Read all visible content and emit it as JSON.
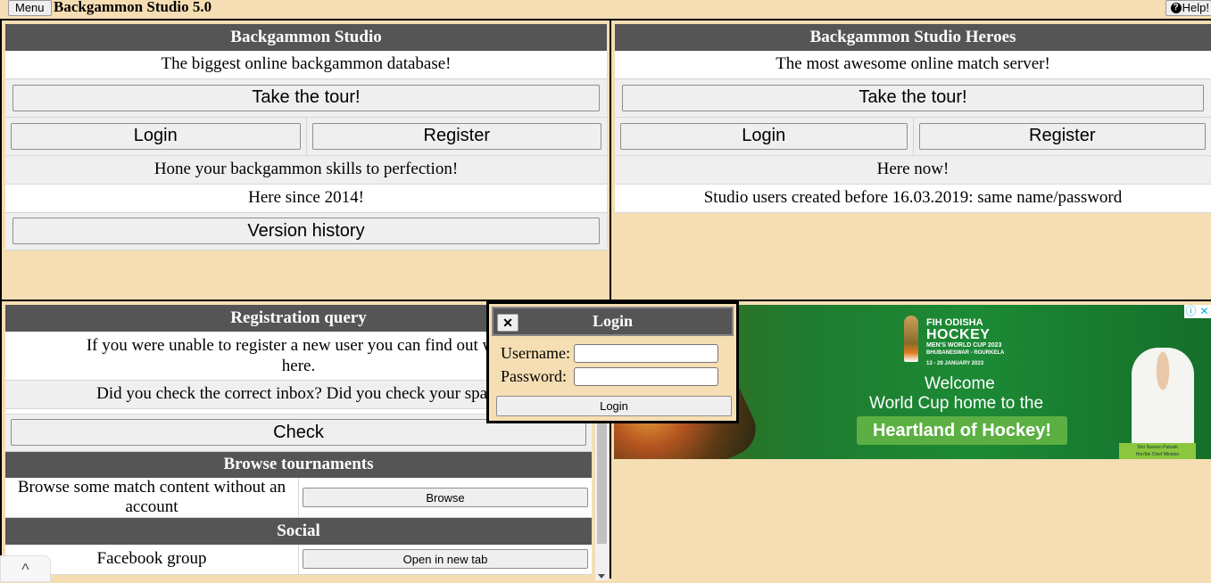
{
  "topbar": {
    "menu_label": "Menu",
    "app_title": "Backgammon Studio 5.0",
    "help_label": "Help!"
  },
  "studio": {
    "title": "Backgammon Studio",
    "tagline": "The biggest online backgammon database!",
    "tour_label": "Take the tour!",
    "login_label": "Login",
    "register_label": "Register",
    "hone": "Hone your backgammon skills to perfection!",
    "since": "Here since 2014!",
    "version_history_label": "Version history"
  },
  "heroes": {
    "title": "Backgammon Studio Heroes",
    "tagline": "The most awesome online match server!",
    "tour_label": "Take the tour!",
    "login_label": "Login",
    "register_label": "Register",
    "here_now": "Here now!",
    "note": "Studio users created before 16.03.2019: same name/password"
  },
  "registration": {
    "title": "Registration query",
    "text1": "If you were unable to register a new user you can find out what happened here.",
    "text1_visible_line1": "If you were unable to register a new user you can find out wha",
    "text1_visible_line2": "here.",
    "text2": "Did you check the correct inbox? Did you check your spam",
    "check_label": "Check"
  },
  "browse": {
    "title": "Browse tournaments",
    "text": "Browse some match content without an account",
    "button_label": "Browse"
  },
  "social": {
    "title": "Social",
    "items": [
      {
        "label": "Facebook group",
        "button_label": "Open in new tab"
      }
    ]
  },
  "login_dialog": {
    "title": "Login",
    "close_label": "✕",
    "username_label": "Username:",
    "password_label": "Password:",
    "username_value": "",
    "password_value": "",
    "submit_label": "Login"
  },
  "ad": {
    "brand_line1": "FIH ODISHA",
    "brand_line2": "HOCKEY",
    "brand_line3": "MEN'S WORLD CUP 2023",
    "brand_line4": "BHUBANESWAR - ROURKELA",
    "dates": "13 - 29 JANUARY 2023",
    "welcome": "Welcome",
    "line2": "World Cup home to the",
    "cta": "Heartland of Hockey!",
    "person_name": "Shri Naveen Patnaik",
    "person_title": "Hon'ble Chief Minister",
    "info_icon": "ⓘ",
    "close_icon": "✕"
  },
  "page_scroll": {
    "up_icon": "^"
  }
}
